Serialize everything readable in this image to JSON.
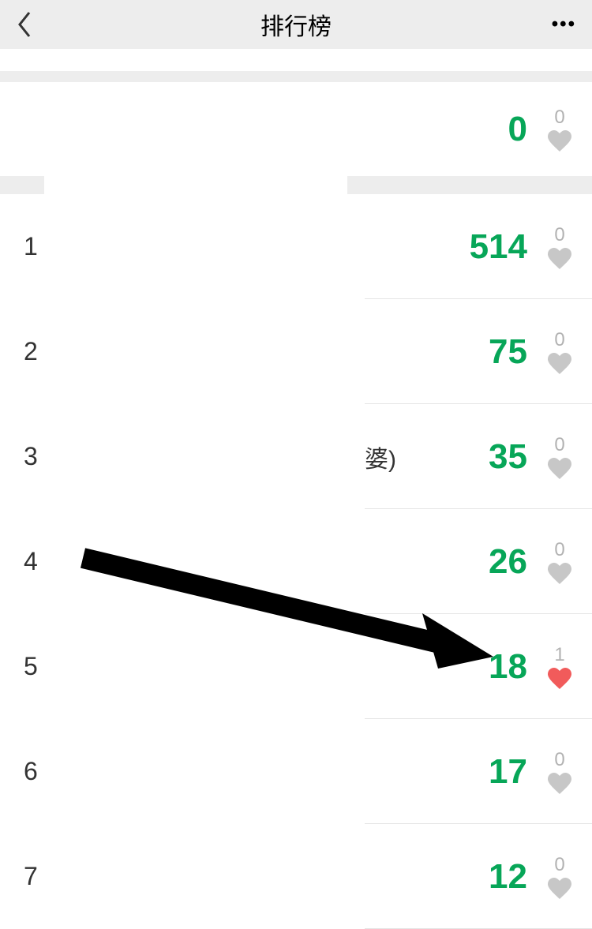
{
  "header": {
    "title": "排行榜"
  },
  "self": {
    "score": "0",
    "likes": "0",
    "liked": false
  },
  "rows": [
    {
      "rank": "1",
      "name_fragment": "",
      "score": "514",
      "likes": "0",
      "liked": false
    },
    {
      "rank": "2",
      "name_fragment": "",
      "score": "75",
      "likes": "0",
      "liked": false
    },
    {
      "rank": "3",
      "name_fragment": "婆)",
      "score": "35",
      "likes": "0",
      "liked": false
    },
    {
      "rank": "4",
      "name_fragment": "",
      "score": "26",
      "likes": "0",
      "liked": false
    },
    {
      "rank": "5",
      "name_fragment": "",
      "score": "18",
      "likes": "1",
      "liked": true
    },
    {
      "rank": "6",
      "name_fragment": "",
      "score": "17",
      "likes": "0",
      "liked": false
    },
    {
      "rank": "7",
      "name_fragment": "",
      "score": "12",
      "likes": "0",
      "liked": false
    }
  ],
  "colors": {
    "score": "#07a658",
    "heart_off": "#c7c7c7",
    "heart_on": "#f15b5b"
  }
}
